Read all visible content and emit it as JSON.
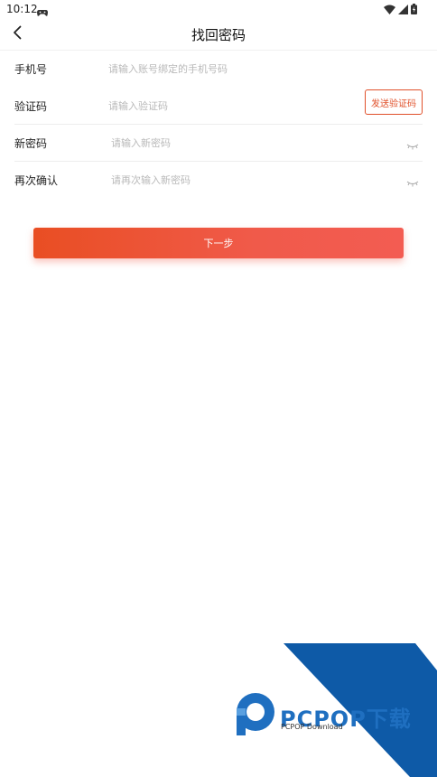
{
  "status_bar": {
    "time": "10:12",
    "icons": [
      "gamepad-icon",
      "wifi-icon",
      "signal-icon",
      "battery-icon"
    ]
  },
  "nav": {
    "title": "找回密码",
    "back_icon": "chevron-left-icon"
  },
  "form": {
    "phone": {
      "label": "手机号",
      "placeholder": "请输入账号绑定的手机号码",
      "value": ""
    },
    "code": {
      "label": "验证码",
      "placeholder": "请输入验证码",
      "value": "",
      "send_button": "发送验证码"
    },
    "new_password": {
      "label": "新密码",
      "placeholder": "请输入新密码",
      "value": "",
      "toggle_icon": "eye-closed-icon"
    },
    "confirm_password": {
      "label": "再次确认",
      "placeholder": "请再次输入新密码",
      "value": "",
      "toggle_icon": "eye-closed-icon"
    }
  },
  "next_button": "下一步",
  "watermark": {
    "brand": "PCPOP下载",
    "subtitle": "PCPOP Download"
  },
  "colors": {
    "accent": "#e94e23",
    "button_end": "#f35c52",
    "watermark_blue": "#0e5aa7"
  }
}
